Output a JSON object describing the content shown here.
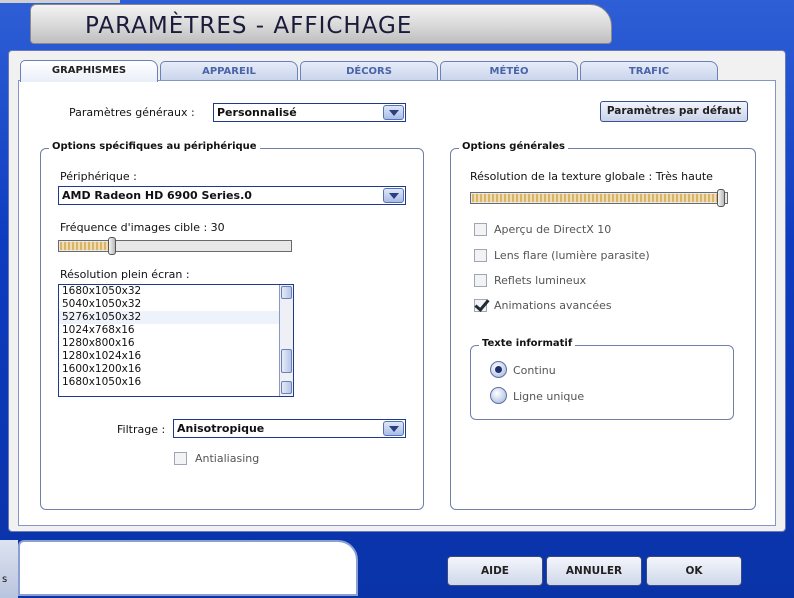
{
  "window": {
    "title": "PARAMÈTRES - AFFICHAGE",
    "accent": "#0e3cc0"
  },
  "tabs": [
    {
      "label": "GRAPHISMES",
      "active": true
    },
    {
      "label": "APPAREIL",
      "active": false
    },
    {
      "label": "DÉCORS",
      "active": false
    },
    {
      "label": "MÉTÉO",
      "active": false
    },
    {
      "label": "TRAFIC",
      "active": false
    }
  ],
  "general": {
    "label": "Paramètres généraux :",
    "value": "Personnalisé",
    "defaults_button": "Paramètres par défaut"
  },
  "device_group": {
    "caption": "Options spécifiques au périphérique",
    "device_label": "Périphérique :",
    "device_value": "AMD Radeon HD 6900 Series.0",
    "framerate_label": "Fréquence d'images cible : 30",
    "framerate_level": 0.22,
    "resolution_label": "Résolution plein écran :",
    "resolutions": [
      "1680x1050x32",
      "5040x1050x32",
      "5276x1050x32",
      "1024x768x16",
      "1280x800x16",
      "1280x1024x16",
      "1600x1200x16",
      "1680x1050x16"
    ],
    "selected_index": 2,
    "filter_label": "Filtrage :",
    "filter_value": "Anisotropique",
    "antialiasing_label": "Antialiasing",
    "antialiasing_checked": false
  },
  "general_group": {
    "caption": "Options générales",
    "texture_label": "Résolution de la texture globale : Très haute",
    "texture_level": 1.0,
    "options": [
      {
        "label": "Aperçu de DirectX 10",
        "checked": false
      },
      {
        "label": "Lens flare (lumière parasite)",
        "checked": false
      },
      {
        "label": "Reflets lumineux",
        "checked": false
      },
      {
        "label": "Animations avancées",
        "checked": true
      }
    ],
    "info_group": {
      "caption": "Texte informatif",
      "options": [
        {
          "label": "Continu",
          "selected": true
        },
        {
          "label": "Ligne unique",
          "selected": false
        }
      ]
    }
  },
  "footer": {
    "help": "AIDE",
    "cancel": "ANNULER",
    "ok": "OK",
    "left_fragment": "s"
  }
}
